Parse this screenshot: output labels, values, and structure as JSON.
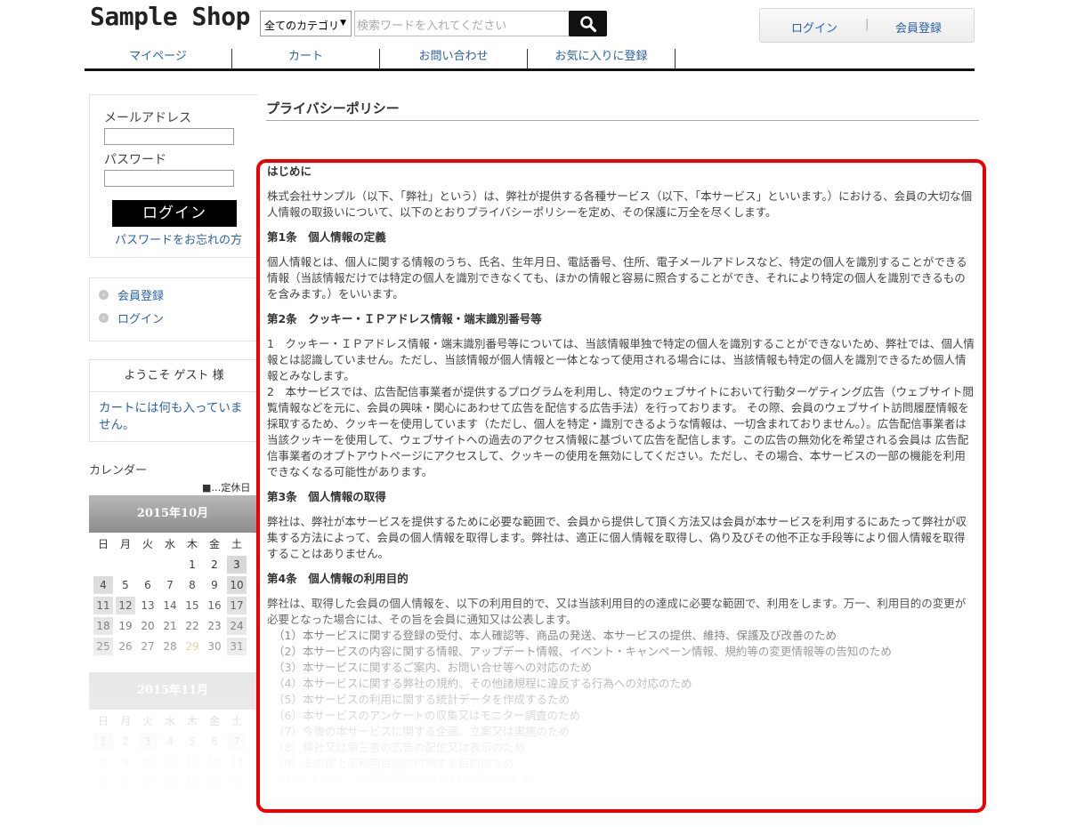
{
  "header": {
    "logo": "Sample Shop",
    "category_select": "全てのカテゴリ",
    "search_placeholder": "検索ワードを入れてください",
    "login_link": "ログイン",
    "separator": "|",
    "register_link": "会員登録"
  },
  "gnav": [
    "マイページ",
    "カート",
    "お問い合わせ",
    "お気に入りに登録"
  ],
  "sidebar": {
    "email_label": "メールアドレス",
    "password_label": "パスワード",
    "login_button": "ログイン",
    "forgot_password": "パスワードをお忘れの方",
    "member_links": [
      "会員登録",
      "ログイン"
    ],
    "welcome": "ようこそ ゲスト 様",
    "cart_empty": "カートには何も入っていません。",
    "calendar_label": "カレンダー",
    "holiday_note": "■…定休日"
  },
  "calendar": {
    "weekdays": [
      "日",
      "月",
      "火",
      "水",
      "木",
      "金",
      "土"
    ],
    "october": {
      "title": "2015年10月",
      "weeks": [
        [
          "",
          "",
          "",
          "",
          "1",
          "2",
          "3"
        ],
        [
          "4",
          "5",
          "6",
          "7",
          "8",
          "9",
          "10"
        ],
        [
          "11",
          "12",
          "13",
          "14",
          "15",
          "16",
          "17"
        ],
        [
          "18",
          "19",
          "20",
          "21",
          "22",
          "23",
          "24"
        ],
        [
          "25",
          "26",
          "27",
          "28",
          "29",
          "30",
          "31"
        ]
      ],
      "holidays": [
        "3",
        "4",
        "10",
        "11",
        "12",
        "17",
        "18",
        "24",
        "25",
        "31"
      ],
      "today": "29"
    },
    "november": {
      "title": "2015年11月",
      "weeks": [
        [
          "1",
          "2",
          "3",
          "4",
          "5",
          "6",
          "7"
        ],
        [
          "8",
          "9",
          "10",
          "11",
          "12",
          "13",
          "14"
        ],
        [
          "15",
          "16",
          "17",
          "18",
          "19",
          "20",
          "21"
        ]
      ],
      "holidays": [
        "1",
        "3",
        "7"
      ]
    }
  },
  "page": {
    "title": "プライバシーポリシー"
  },
  "policy": {
    "intro_heading": "はじめに",
    "intro_text": "株式会社サンプル（以下、「弊社」という）は、弊社が提供する各種サービス（以下、「本サービス」といいます。）における、会員の大切な個人情報の取扱いについて、以下のとおりプライバシーポリシーを定め、その保護に万全を尽くします。",
    "art1_heading": "第1条　個人情報の定義",
    "art1_text": "個人情報とは、個人に関する情報のうち、氏名、生年月日、電話番号、住所、電子メールアドレスなど、特定の個人を識別することができる情報（当該情報だけでは特定の個人を識別できなくても、ほかの情報と容易に照合することができ、それにより特定の個人を識別できるものを含みます。）をいいます。",
    "art2_heading": "第2条　クッキー・ＩＰアドレス情報・端末識別番号等",
    "art2_p1": "1　クッキー・ＩＰアドレス情報・端末識別番号等については、当該情報単独で特定の個人を識別することができないため、弊社では、個人情報とは認識していません。ただし、当該情報が個人情報と一体となって使用される場合には、当該情報も特定の個人を識別できるため個人情報とみなします。",
    "art2_p2": "2　本サービスでは、広告配信事業者が提供するプログラムを利用し、特定のウェブサイトにおいて行動ターゲティング広告（ウェブサイト閲覧情報などを元に、会員の興味・関心にあわせて広告を配信する広告手法）を行っております。 その際、会員のウェブサイト訪問履歴情報を採取するため、クッキーを使用しています（ただし、個人を特定・識別できるような情報は、一切含まれておりません。）。広告配信事業者は 当該クッキーを使用して、ウェブサイトへの過去のアクセス情報に基づいて広告を配信します。この広告の無効化を希望される会員は 広告配信事業者のオプトアウトページにアクセスして、クッキーの使用を無効にしてください。ただし、その場合、本サービスの一部の機能を利用できなくなる可能性があります。",
    "art3_heading": "第3条　個人情報の取得",
    "art3_text": "弊社は、弊社が本サービスを提供するために必要な範囲で、会員から提供して頂く方法又は会員が本サービスを利用するにあたって弊社が収集する方法によって、会員の個人情報を取得します。弊社は、適正に個人情報を取得し、偽り及びその他不正な手段等により個人情報を取得することはありません。",
    "art4_heading": "第4条　個人情報の利用目的",
    "art4_text": "弊社は、取得した会員の個人情報を、以下の利用目的で、又は当該利用目的の達成に必要な範囲で、利用をします。万一、利用目的の変更が必要となった場合には、その旨を会員に通知又は公表します。",
    "art4_items": [
      "（1）本サービスに関する登録の受付、本人確認等、商品の発送、本サービスの提供、維持、保護及び改善のため",
      "（2）本サービスの内容に関する情報、アップデート情報、イベント・キャンペーン情報、規約等の変更情報等の告知のため",
      "（3）本サービスに関するご案内、お問い合せ等への対応のため",
      "（4）本サービスに関する弊社の規約、その他諸規程に違反する行為への対応のため",
      "（5）本サービスの利用に関する統計データを作成するため",
      "（6）本サービスのアンケートの収集又はモニター調査のため",
      "（7）今後の本サービスに関する企画、立案又は実施のため",
      "（8）弊社又は第三者の広告の配信又は表示のため",
      "（9）その他上記利用目的に付随する目的のため",
      "（10）その他、上記利用目的に付随する目的のため"
    ]
  },
  "colors": {
    "link": "#2a61a8",
    "highlight_border": "#ee0000",
    "calendar_header": "#9e9e9e",
    "today": "#e8a040"
  }
}
